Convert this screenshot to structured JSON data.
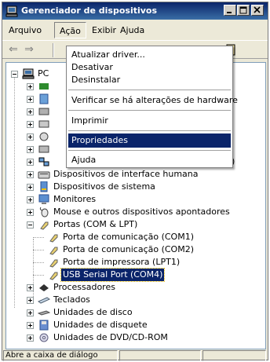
{
  "window": {
    "title": "Gerenciador de dispositivos",
    "icon": "device-manager-icon"
  },
  "menubar": {
    "items": [
      "Arquivo",
      "Ação",
      "Exibir",
      "Ajuda"
    ],
    "open_item": "Ação"
  },
  "dropdown": {
    "items": [
      {
        "label": "Atualizar driver...",
        "highlighted": false
      },
      {
        "label": "Desativar",
        "highlighted": false
      },
      {
        "label": "Desinstalar",
        "highlighted": false
      },
      {
        "label": "Verificar se há alterações de hardware",
        "highlighted": false
      },
      {
        "label": "Imprimir",
        "highlighted": false
      },
      {
        "label": "Propriedades",
        "highlighted": true
      },
      {
        "label": "Ajuda",
        "highlighted": false
      }
    ]
  },
  "tree": {
    "root_partial": "PC",
    "partial_right_text": "l)",
    "items": [
      {
        "label": "Dispositivos de interface humana",
        "icon": "hid-icon"
      },
      {
        "label": "Dispositivos de sistema",
        "icon": "system-devices-icon"
      },
      {
        "label": "Monitores",
        "icon": "monitor-icon"
      },
      {
        "label": "Mouse e outros dispositivos apontadores",
        "icon": "mouse-icon"
      },
      {
        "label": "Portas (COM & LPT)",
        "icon": "port-icon"
      },
      {
        "label": "Porta de comunicação (COM1)",
        "icon": "port-icon"
      },
      {
        "label": "Porta de comunicação (COM2)",
        "icon": "port-icon"
      },
      {
        "label": "Porta de impressora (LPT1)",
        "icon": "port-icon"
      },
      {
        "label": "USB Serial Port (COM4)",
        "icon": "port-icon",
        "selected": true
      },
      {
        "label": "Processadores",
        "icon": "processor-icon"
      },
      {
        "label": "Teclados",
        "icon": "keyboard-icon"
      },
      {
        "label": "Unidades de disco",
        "icon": "disk-icon"
      },
      {
        "label": "Unidades de disquete",
        "icon": "floppy-icon"
      },
      {
        "label": "Unidades de DVD/CD-ROM",
        "icon": "cdrom-icon"
      }
    ]
  },
  "statusbar": {
    "text": "Abre a caixa de diálogo"
  },
  "colors": {
    "titlebar": "#0a246a",
    "selection": "#0a246a",
    "face": "#ece9d8"
  }
}
